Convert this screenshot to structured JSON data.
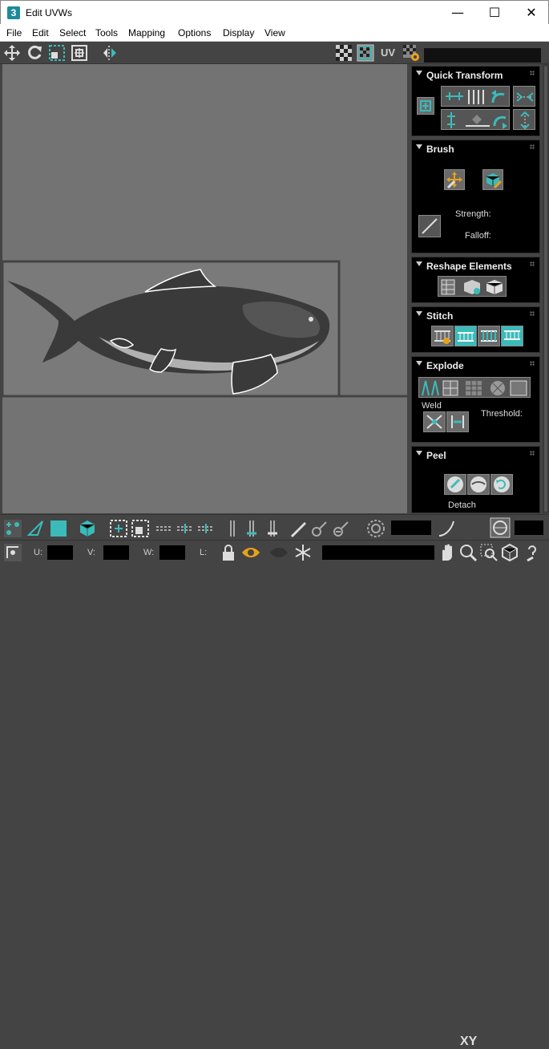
{
  "window": {
    "title": "Edit UVWs",
    "app_icon_text": "3",
    "minimize": "—",
    "maximize": "☐",
    "close": "✕"
  },
  "menu": [
    "File",
    "Edit",
    "Select",
    "Tools",
    "Mapping",
    "Options",
    "Display",
    "View"
  ],
  "toolbar": {
    "uv_label": "UV"
  },
  "panels": {
    "quick_transform": {
      "title": "Quick Transform"
    },
    "brush": {
      "title": "Brush",
      "strength_label": "Strength:",
      "falloff_label": "Falloff:"
    },
    "reshape": {
      "title": "Reshape Elements"
    },
    "stitch": {
      "title": "Stitch"
    },
    "explode": {
      "title": "Explode",
      "weld_label": "Weld",
      "threshold_label": "Threshold:"
    },
    "peel": {
      "title": "Peel",
      "detach_label": "Detach"
    }
  },
  "status": {
    "xy_label": "XY",
    "u_label": "U:",
    "v_label": "V:",
    "w_label": "W:",
    "l_label": "L:"
  },
  "colors": {
    "accent": "#3cbaba",
    "viewport_bg": "#737373",
    "panel_bg": "#000000",
    "chrome": "#444444"
  }
}
